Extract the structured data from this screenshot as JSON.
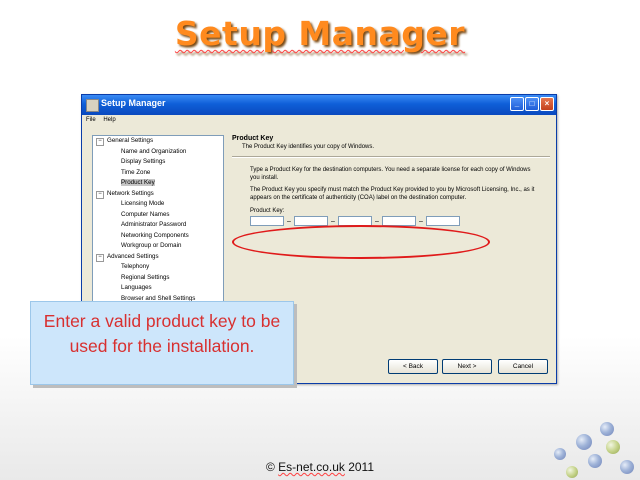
{
  "slide": {
    "title": "Setup Manager",
    "footer_prefix": "© ",
    "footer_link": "Es-net.co.uk",
    "footer_suffix": " 2011"
  },
  "window": {
    "title": "Setup Manager",
    "menu": [
      "File",
      "Help"
    ],
    "tree": [
      {
        "label": "General Settings",
        "level": 0,
        "expander": "−"
      },
      {
        "label": "Name and Organization",
        "level": 1
      },
      {
        "label": "Display Settings",
        "level": 1
      },
      {
        "label": "Time Zone",
        "level": 1
      },
      {
        "label": "Product Key",
        "level": 1,
        "selected": true
      },
      {
        "label": "Network Settings",
        "level": 0,
        "expander": "−"
      },
      {
        "label": "Licensing Mode",
        "level": 1
      },
      {
        "label": "Computer Names",
        "level": 1
      },
      {
        "label": "Administrator Password",
        "level": 1
      },
      {
        "label": "Networking Components",
        "level": 1
      },
      {
        "label": "Workgroup or Domain",
        "level": 1
      },
      {
        "label": "Advanced Settings",
        "level": 0,
        "expander": "−"
      },
      {
        "label": "Telephony",
        "level": 1
      },
      {
        "label": "Regional Settings",
        "level": 1
      },
      {
        "label": "Languages",
        "level": 1
      },
      {
        "label": "Browser and Shell Settings",
        "level": 1
      }
    ],
    "panel": {
      "heading": "Product Key",
      "subheading": "The Product Key identifies your copy of Windows.",
      "para1": "Type a Product Key for the destination computers. You need a separate license for each copy of Windows you install.",
      "para2": "The Product Key you specify must match the Product Key provided to you by Microsoft Licensing, Inc., as it appears on the certificate of authenticity (COA) label on the destination computer.",
      "key_label": "Product Key:",
      "key_fields": [
        "",
        "",
        "",
        "",
        ""
      ],
      "separator": "–"
    },
    "buttons": {
      "back": "< Back",
      "next": "Next >",
      "cancel": "Cancel"
    }
  },
  "callout": {
    "text": "Enter a valid product key to be used for the installation."
  },
  "colors": {
    "title": "#ff8a1e",
    "callout_text": "#d83030",
    "callout_bg": "#cde6fb",
    "highlight": "#e01a1a"
  }
}
